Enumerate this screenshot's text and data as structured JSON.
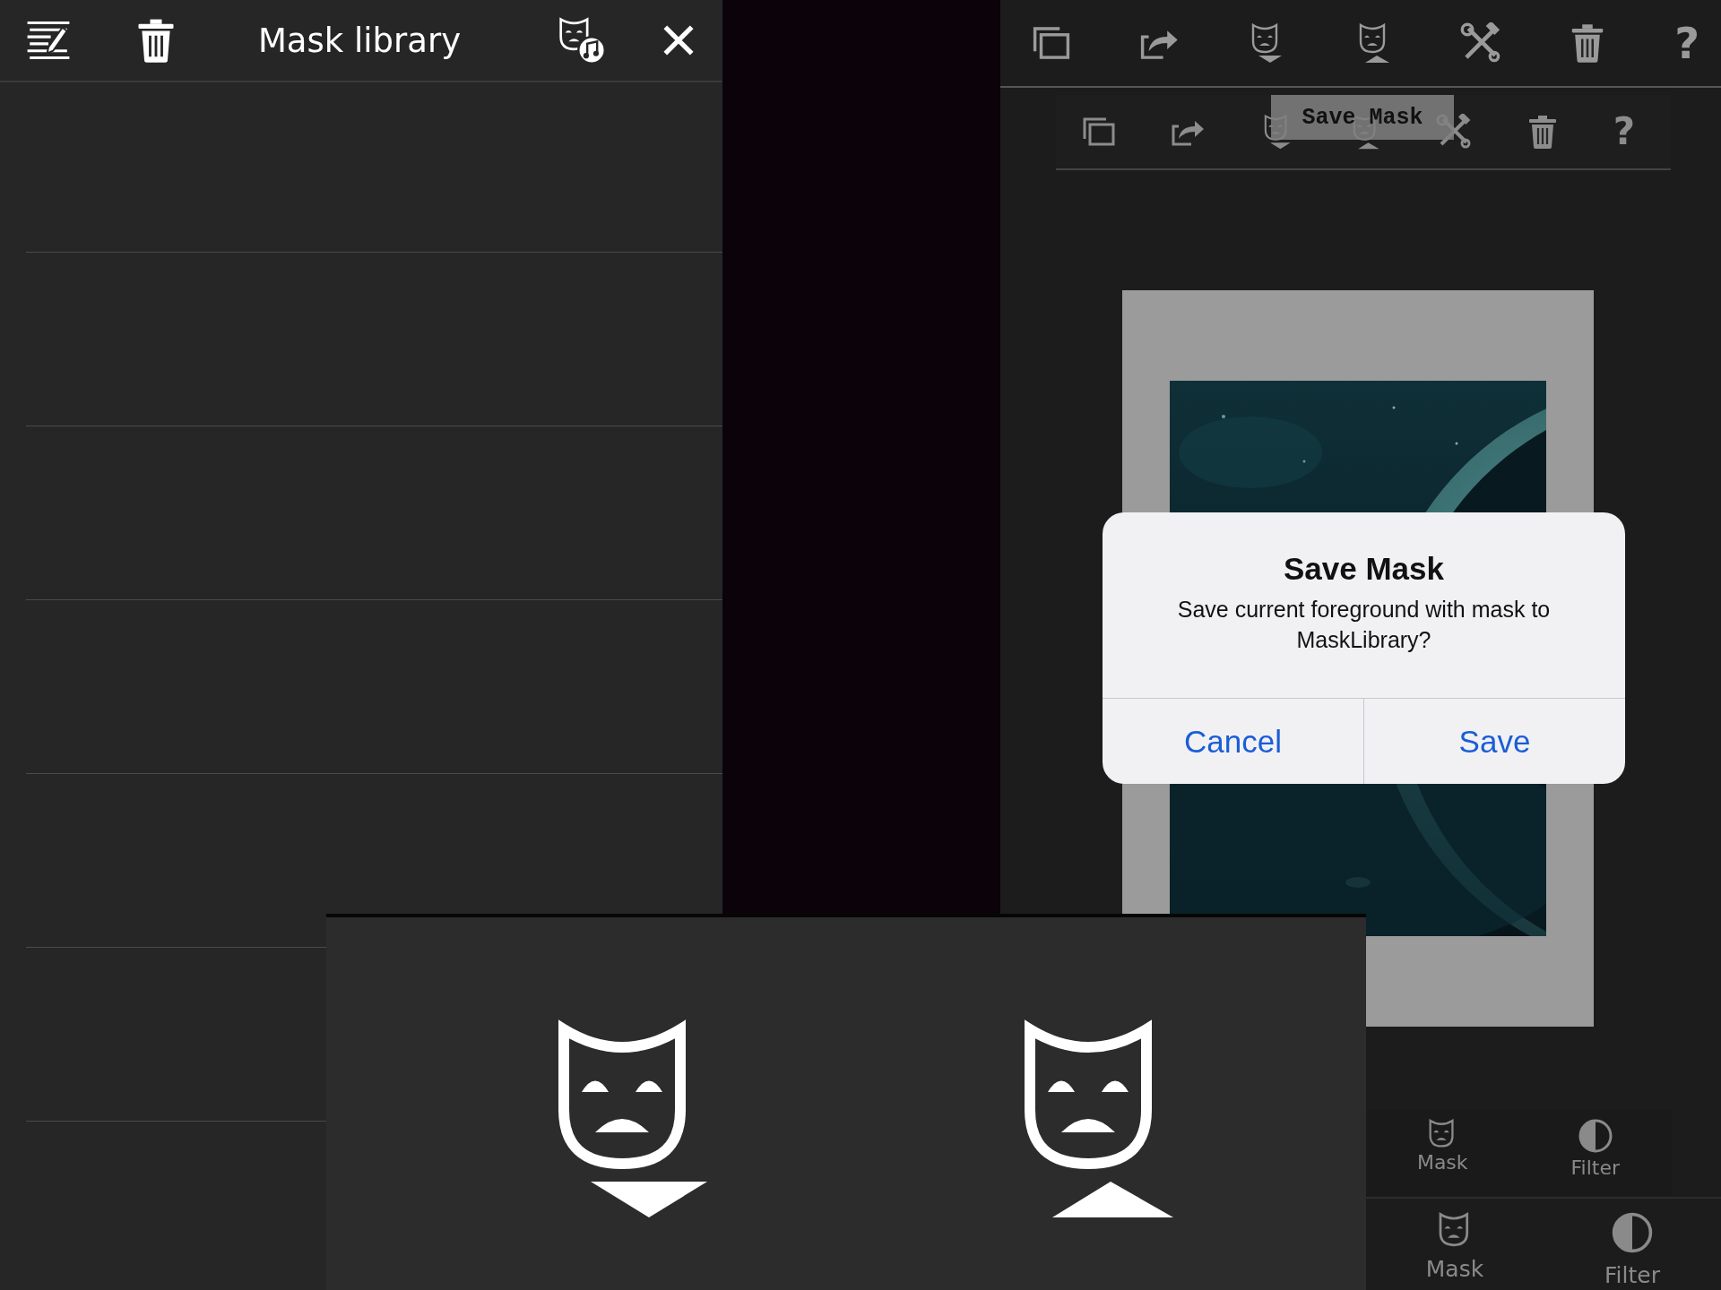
{
  "mask_library": {
    "title": "Mask library",
    "toolbar": [
      {
        "kind": "edit-list"
      },
      {
        "kind": "trash"
      }
    ],
    "actions": [
      {
        "kind": "mask-music"
      },
      {
        "kind": "close"
      }
    ]
  },
  "editor": {
    "toolbar": [
      {
        "kind": "copy"
      },
      {
        "kind": "share"
      },
      {
        "kind": "mask-down"
      },
      {
        "kind": "mask-up"
      },
      {
        "kind": "tools"
      },
      {
        "kind": "trash"
      },
      {
        "kind": "help",
        "label": "?"
      }
    ],
    "secondary_toolbar": [
      {
        "kind": "copy"
      },
      {
        "kind": "share"
      },
      {
        "kind": "mask-down"
      },
      {
        "kind": "mask-up"
      },
      {
        "kind": "tools"
      },
      {
        "kind": "trash"
      },
      {
        "kind": "help",
        "label": "?"
      }
    ],
    "tooltip": "Save Mask",
    "dialog": {
      "title": "Save Mask",
      "message": "Save current foreground with mask to MaskLibrary?",
      "buttons": [
        {
          "label": "Cancel"
        },
        {
          "label": "Save"
        }
      ]
    },
    "tab_bars": [
      {
        "tabs": [
          {
            "kind": "mask",
            "label": "Mask"
          },
          {
            "kind": "filter",
            "label": "Filter"
          }
        ]
      },
      {
        "tabs": [
          {
            "kind": "mask",
            "label": "Mask"
          },
          {
            "kind": "filter",
            "label": "Filter"
          }
        ]
      }
    ]
  },
  "zoomed_buttons": [
    {
      "kind": "mask-down"
    },
    {
      "kind": "mask-up"
    }
  ]
}
